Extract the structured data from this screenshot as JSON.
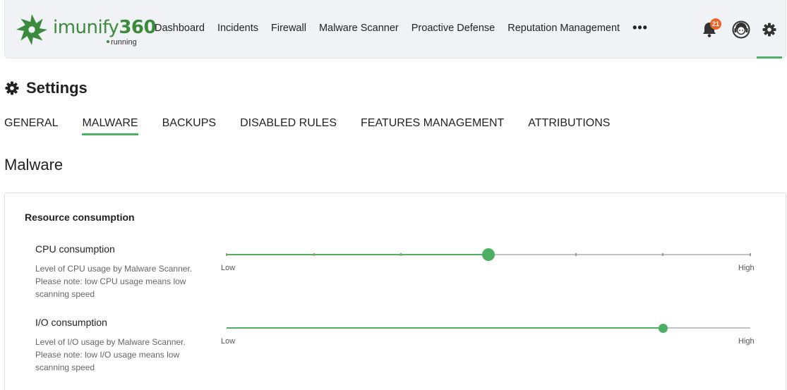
{
  "app": {
    "logo_text": "imunify",
    "logo_number": "360",
    "status": "running"
  },
  "nav": {
    "items": [
      "Dashboard",
      "Incidents",
      "Firewall",
      "Malware Scanner",
      "Proactive Defense",
      "Reputation Management"
    ],
    "more_label": "•••",
    "notifications_count": "21"
  },
  "page": {
    "title": "Settings",
    "tabs": [
      "GENERAL",
      "MALWARE",
      "BACKUPS",
      "DISABLED RULES",
      "FEATURES MANAGEMENT",
      "ATTRIBUTIONS"
    ],
    "active_tab": "MALWARE",
    "section_title": "Malware"
  },
  "card": {
    "title": "Resource consumption",
    "settings": [
      {
        "name": "CPU consumption",
        "description": "Level of CPU usage by Malware Scanner. Please note: low CPU usage means low scanning speed",
        "min_label": "Low",
        "max_label": "High",
        "value": 0.5,
        "steps": 6
      },
      {
        "name": "I/O consumption",
        "description": "Level of I/O usage by Malware Scanner. Please note: low I/O usage means low scanning speed",
        "min_label": "Low",
        "max_label": "High",
        "value": 0.833,
        "steps": 6
      }
    ]
  },
  "colors": {
    "accent": "#4caf62",
    "brand": "#3c8a3e",
    "badge": "#e8662c"
  }
}
